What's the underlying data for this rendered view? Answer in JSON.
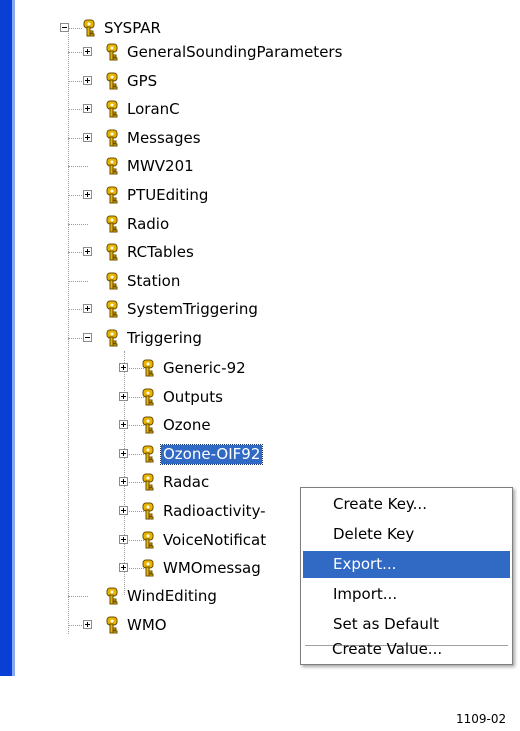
{
  "tree": {
    "root": {
      "label": "SYSPAR",
      "expanded": true
    },
    "children": [
      {
        "label": "GeneralSoundingParameters",
        "expandable": true
      },
      {
        "label": "GPS",
        "expandable": true
      },
      {
        "label": "LoranC",
        "expandable": true
      },
      {
        "label": "Messages",
        "expandable": true
      },
      {
        "label": "MWV201",
        "expandable": false
      },
      {
        "label": "PTUEditing",
        "expandable": true
      },
      {
        "label": "Radio",
        "expandable": false
      },
      {
        "label": "RCTables",
        "expandable": true
      },
      {
        "label": "Station",
        "expandable": false
      },
      {
        "label": "SystemTriggering",
        "expandable": true
      },
      {
        "label": "Triggering",
        "expandable": true,
        "expanded": true
      },
      {
        "label": "WindEditing",
        "expandable": false
      },
      {
        "label": "WMO",
        "expandable": true
      }
    ],
    "triggering_children": [
      {
        "label": "Generic-92"
      },
      {
        "label": "Outputs"
      },
      {
        "label": "Ozone"
      },
      {
        "label": "Ozone-OIF92",
        "selected": true
      },
      {
        "label": "Radac"
      },
      {
        "label": "Radioactivity-"
      },
      {
        "label": "VoiceNotificat"
      },
      {
        "label": "WMOmessag"
      }
    ]
  },
  "context_menu": {
    "items": [
      {
        "label": "Create Key..."
      },
      {
        "label": "Delete Key"
      },
      {
        "label": "Export...",
        "active": true
      },
      {
        "label": "Import..."
      },
      {
        "label": "Set as Default"
      },
      {
        "label": "Create Value..."
      }
    ]
  },
  "figure_ref": "1109-02",
  "colors": {
    "selection": "#316ac5",
    "key_icon": "#e8b400",
    "left_bar": "#0a3fd6"
  },
  "icons": {
    "node": "registry-key-icon",
    "expander": "expand-collapse-box-icon"
  }
}
